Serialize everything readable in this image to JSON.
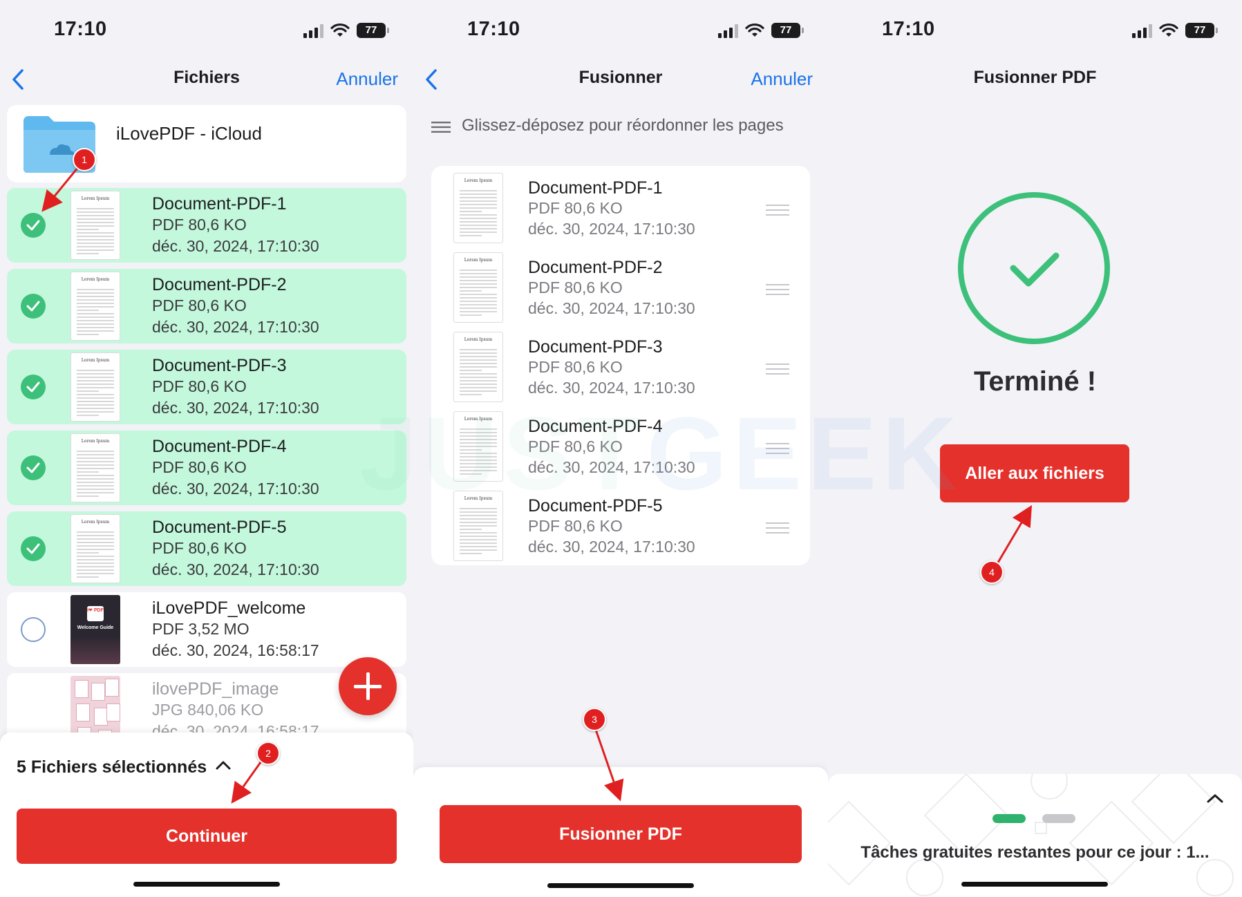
{
  "status_bar": {
    "time": "17:10",
    "battery": "77"
  },
  "screen1": {
    "nav": {
      "title": "Fichiers",
      "cancel": "Annuler"
    },
    "folder": {
      "label": "iLovePDF - iCloud"
    },
    "files": [
      {
        "name": "Document-PDF-1",
        "meta": "PDF 80,6 KO",
        "date": "déc. 30, 2024, 17:10:30",
        "selected": true
      },
      {
        "name": "Document-PDF-2",
        "meta": "PDF 80,6 KO",
        "date": "déc. 30, 2024, 17:10:30",
        "selected": true
      },
      {
        "name": "Document-PDF-3",
        "meta": "PDF 80,6 KO",
        "date": "déc. 30, 2024, 17:10:30",
        "selected": true
      },
      {
        "name": "Document-PDF-4",
        "meta": "PDF 80,6 KO",
        "date": "déc. 30, 2024, 17:10:30",
        "selected": true
      },
      {
        "name": "Document-PDF-5",
        "meta": "PDF 80,6 KO",
        "date": "déc. 30, 2024, 17:10:30",
        "selected": true
      },
      {
        "name": "iLovePDF_welcome",
        "meta": "PDF 3,52 MO",
        "date": "déc. 30, 2024, 16:58:17",
        "selected": false
      },
      {
        "name": "ilovePDF_image",
        "meta": "JPG 840,06 KO",
        "date": "déc. 30, 2024, 16:58:17",
        "selected": false
      }
    ],
    "thumb_caption": "Lorem Ipsum",
    "welcome_thumb": {
      "badge": "I❤ PDF",
      "title": "Welcome Guide"
    },
    "selection_label": "5 Fichiers sélectionnés",
    "continue_button": "Continuer"
  },
  "screen2": {
    "nav": {
      "title": "Fusionner",
      "cancel": "Annuler"
    },
    "hint": "Glissez-déposez pour réordonner les pages",
    "files": [
      {
        "name": "Document-PDF-1",
        "meta": "PDF 80,6 KO",
        "date": "déc. 30, 2024, 17:10:30"
      },
      {
        "name": "Document-PDF-2",
        "meta": "PDF 80,6 KO",
        "date": "déc. 30, 2024, 17:10:30"
      },
      {
        "name": "Document-PDF-3",
        "meta": "PDF 80,6 KO",
        "date": "déc. 30, 2024, 17:10:30"
      },
      {
        "name": "Document-PDF-4",
        "meta": "PDF 80,6 KO",
        "date": "déc. 30, 2024, 17:10:30"
      },
      {
        "name": "Document-PDF-5",
        "meta": "PDF 80,6 KO",
        "date": "déc. 30, 2024, 17:10:30"
      }
    ],
    "merge_button": "Fusionner PDF"
  },
  "screen3": {
    "nav": {
      "title": "Fusionner PDF"
    },
    "done": "Terminé !",
    "go_button": "Aller aux fichiers",
    "tasks": "Tâches gratuites restantes pour ce jour : 1..."
  },
  "annotations": [
    "1",
    "2",
    "3",
    "4"
  ],
  "watermark": {
    "part1": "JUST",
    "part2": "GEEK"
  },
  "colors": {
    "accent_red": "#e4312b",
    "selected_green": "#c3f8dd",
    "check_green": "#3dc07a",
    "link_blue": "#1a73e8",
    "success_green": "#3dc07a"
  },
  "icons": [
    "back-chevron-icon",
    "signal-icon",
    "wifi-icon",
    "battery-icon",
    "folder-icon",
    "checkmark-icon",
    "plus-icon",
    "chevron-up-icon",
    "drag-handle-icon",
    "success-check-icon"
  ]
}
